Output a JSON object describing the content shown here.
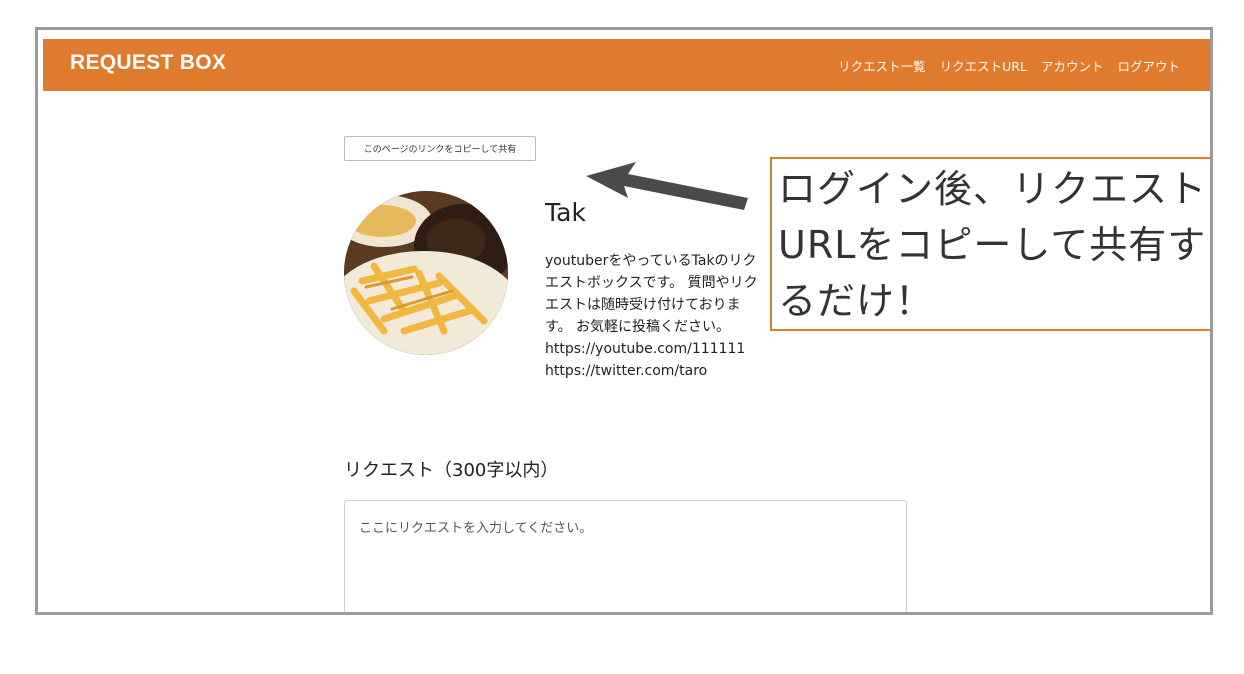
{
  "navbar": {
    "brand": "REQUEST BOX",
    "links": [
      "リクエスト一覧",
      "リクエストURL",
      "アカウント",
      "ログアウト"
    ],
    "color": "#e07a2e"
  },
  "share": {
    "button_label": "このページのリンクをコピーして共有"
  },
  "profile": {
    "name": "Tak",
    "bio": "youtuberをやっているTakのリクエストボックスです。 質問やリクエストは随時受け付けております。 お気軽に投稿ください。\nhttps://youtube.com/111111\nhttps://twitter.com/taro"
  },
  "request": {
    "heading": "リクエスト（300字以内）",
    "placeholder": "ここにリクエストを入力してください。"
  },
  "annotation": {
    "text": "ログイン後、リクエストURLをコピーして共有するだけ！",
    "color": "#e07a2e"
  }
}
